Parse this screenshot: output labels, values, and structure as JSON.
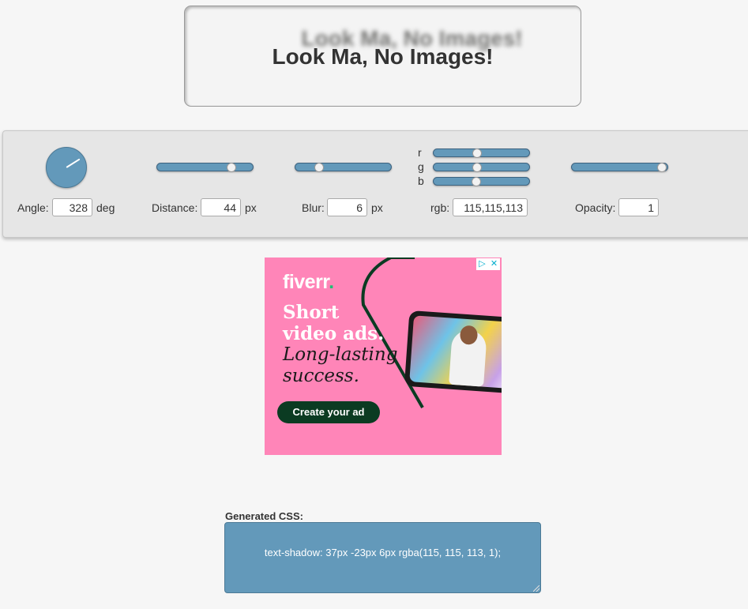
{
  "preview": {
    "text": "Look Ma, No Images!"
  },
  "controls": {
    "angle": {
      "label": "Angle:",
      "value": "328",
      "unit": "deg"
    },
    "distance": {
      "label": "Distance:",
      "value": "44",
      "unit": "px",
      "slider_fraction": 0.78
    },
    "blur": {
      "label": "Blur:",
      "value": "6",
      "unit": "px",
      "slider_fraction": 0.25
    },
    "rgb": {
      "label": "rgb:",
      "value": "115,115,113",
      "channels": [
        {
          "name": "r",
          "value": 115
        },
        {
          "name": "g",
          "value": 115
        },
        {
          "name": "b",
          "value": 113
        }
      ]
    },
    "opacity": {
      "label": "Opacity:",
      "value": "1",
      "slider_fraction": 1.0
    }
  },
  "ad": {
    "brand": "fiverr",
    "brand_dot": ".",
    "headline": [
      "Short",
      "video ads."
    ],
    "subline": [
      "Long-lasting",
      "success."
    ],
    "cta": "Create your ad",
    "icons": [
      "adchoices-icon",
      "close-icon"
    ]
  },
  "output": {
    "label": "Generated CSS:",
    "code": "text-shadow: 37px -23px 6px rgba(115, 115, 113, 1);"
  },
  "colors": {
    "accent": "#6399ba",
    "page_bg": "#f6f6f6",
    "panel_bg": "#e6e6e6",
    "ad_bg": "#ff85b8"
  }
}
